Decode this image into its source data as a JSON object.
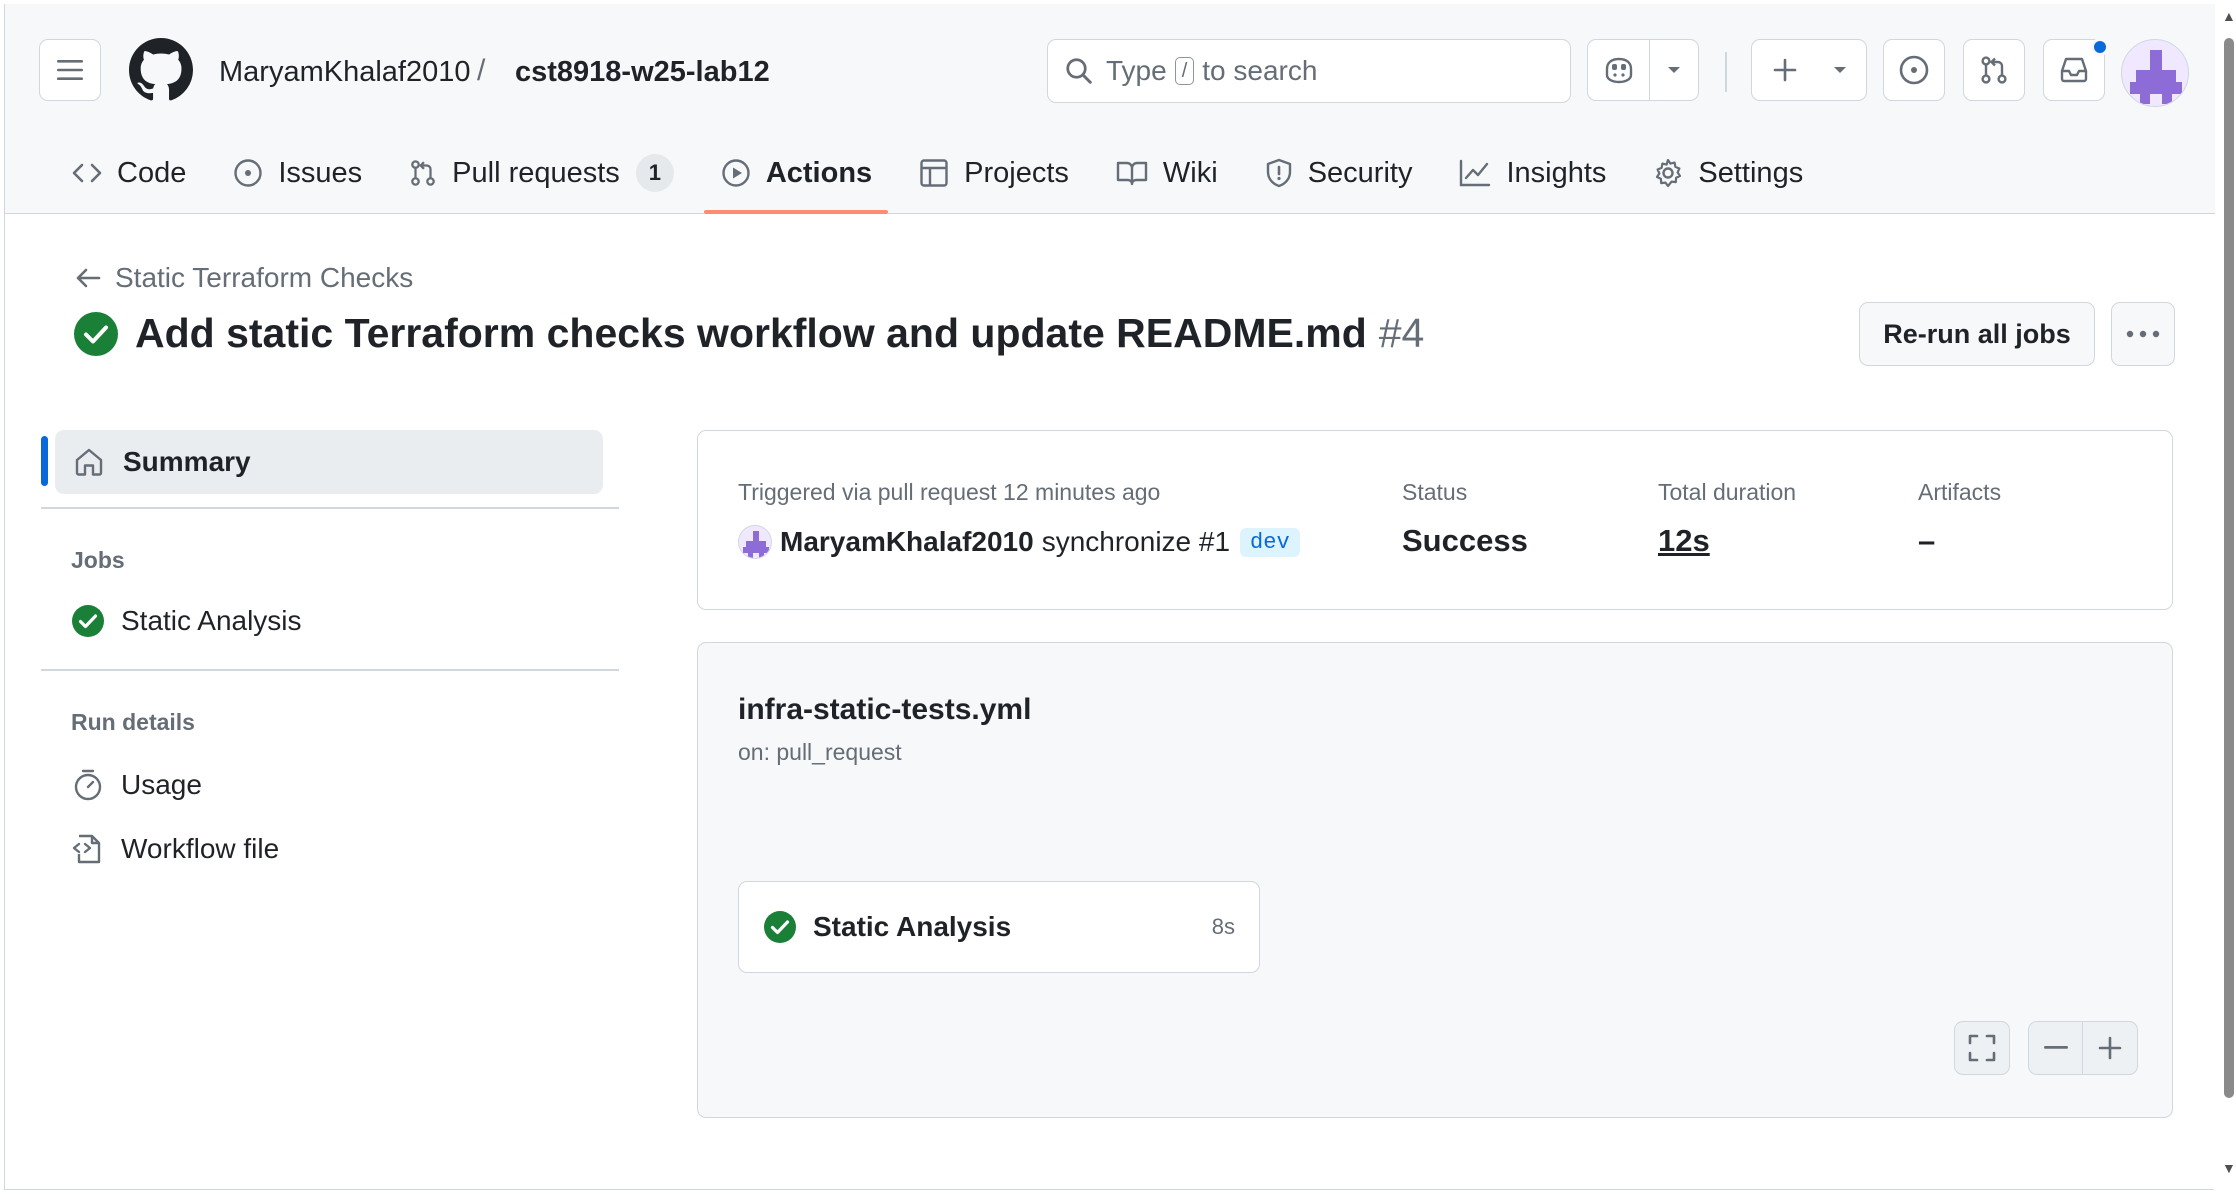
{
  "header": {
    "owner": "MaryamKhalaf2010",
    "separator": "/",
    "repo": "cst8918-w25-lab12",
    "search_prefix": "Type",
    "search_key": "/",
    "search_suffix": "to search"
  },
  "tabs": [
    {
      "label": "Code",
      "icon": "code-icon"
    },
    {
      "label": "Issues",
      "icon": "issue-opened-icon"
    },
    {
      "label": "Pull requests",
      "icon": "git-pull-request-icon",
      "count": "1"
    },
    {
      "label": "Actions",
      "icon": "play-icon",
      "active": true
    },
    {
      "label": "Projects",
      "icon": "table-icon"
    },
    {
      "label": "Wiki",
      "icon": "book-icon"
    },
    {
      "label": "Security",
      "icon": "shield-icon"
    },
    {
      "label": "Insights",
      "icon": "graph-icon"
    },
    {
      "label": "Settings",
      "icon": "gear-icon"
    }
  ],
  "run": {
    "back_label": "Static Terraform Checks",
    "title": "Add static Terraform checks workflow and update README.md",
    "number": "#4",
    "rerun_label": "Re-run all jobs"
  },
  "sidebar": {
    "summary_label": "Summary",
    "jobs_heading": "Jobs",
    "job_label": "Static Analysis",
    "run_details_heading": "Run details",
    "usage_label": "Usage",
    "workflow_file_label": "Workflow file"
  },
  "summary": {
    "triggered_text": "Triggered via pull request 12 minutes ago",
    "actor": "MaryamKhalaf2010",
    "event_text": "synchronize #1",
    "branch": "dev",
    "status_label": "Status",
    "status_value": "Success",
    "duration_label": "Total duration",
    "duration_value": "12s",
    "artifacts_label": "Artifacts",
    "artifacts_value": "–"
  },
  "workflow": {
    "file_name": "infra-static-tests.yml",
    "trigger": "on: pull_request",
    "job_name": "Static Analysis",
    "job_duration": "8s"
  },
  "colors": {
    "success": "#1a7f37",
    "accent": "#0969da",
    "active_tab_underline": "#fd8c73",
    "border": "#d0d7de"
  }
}
